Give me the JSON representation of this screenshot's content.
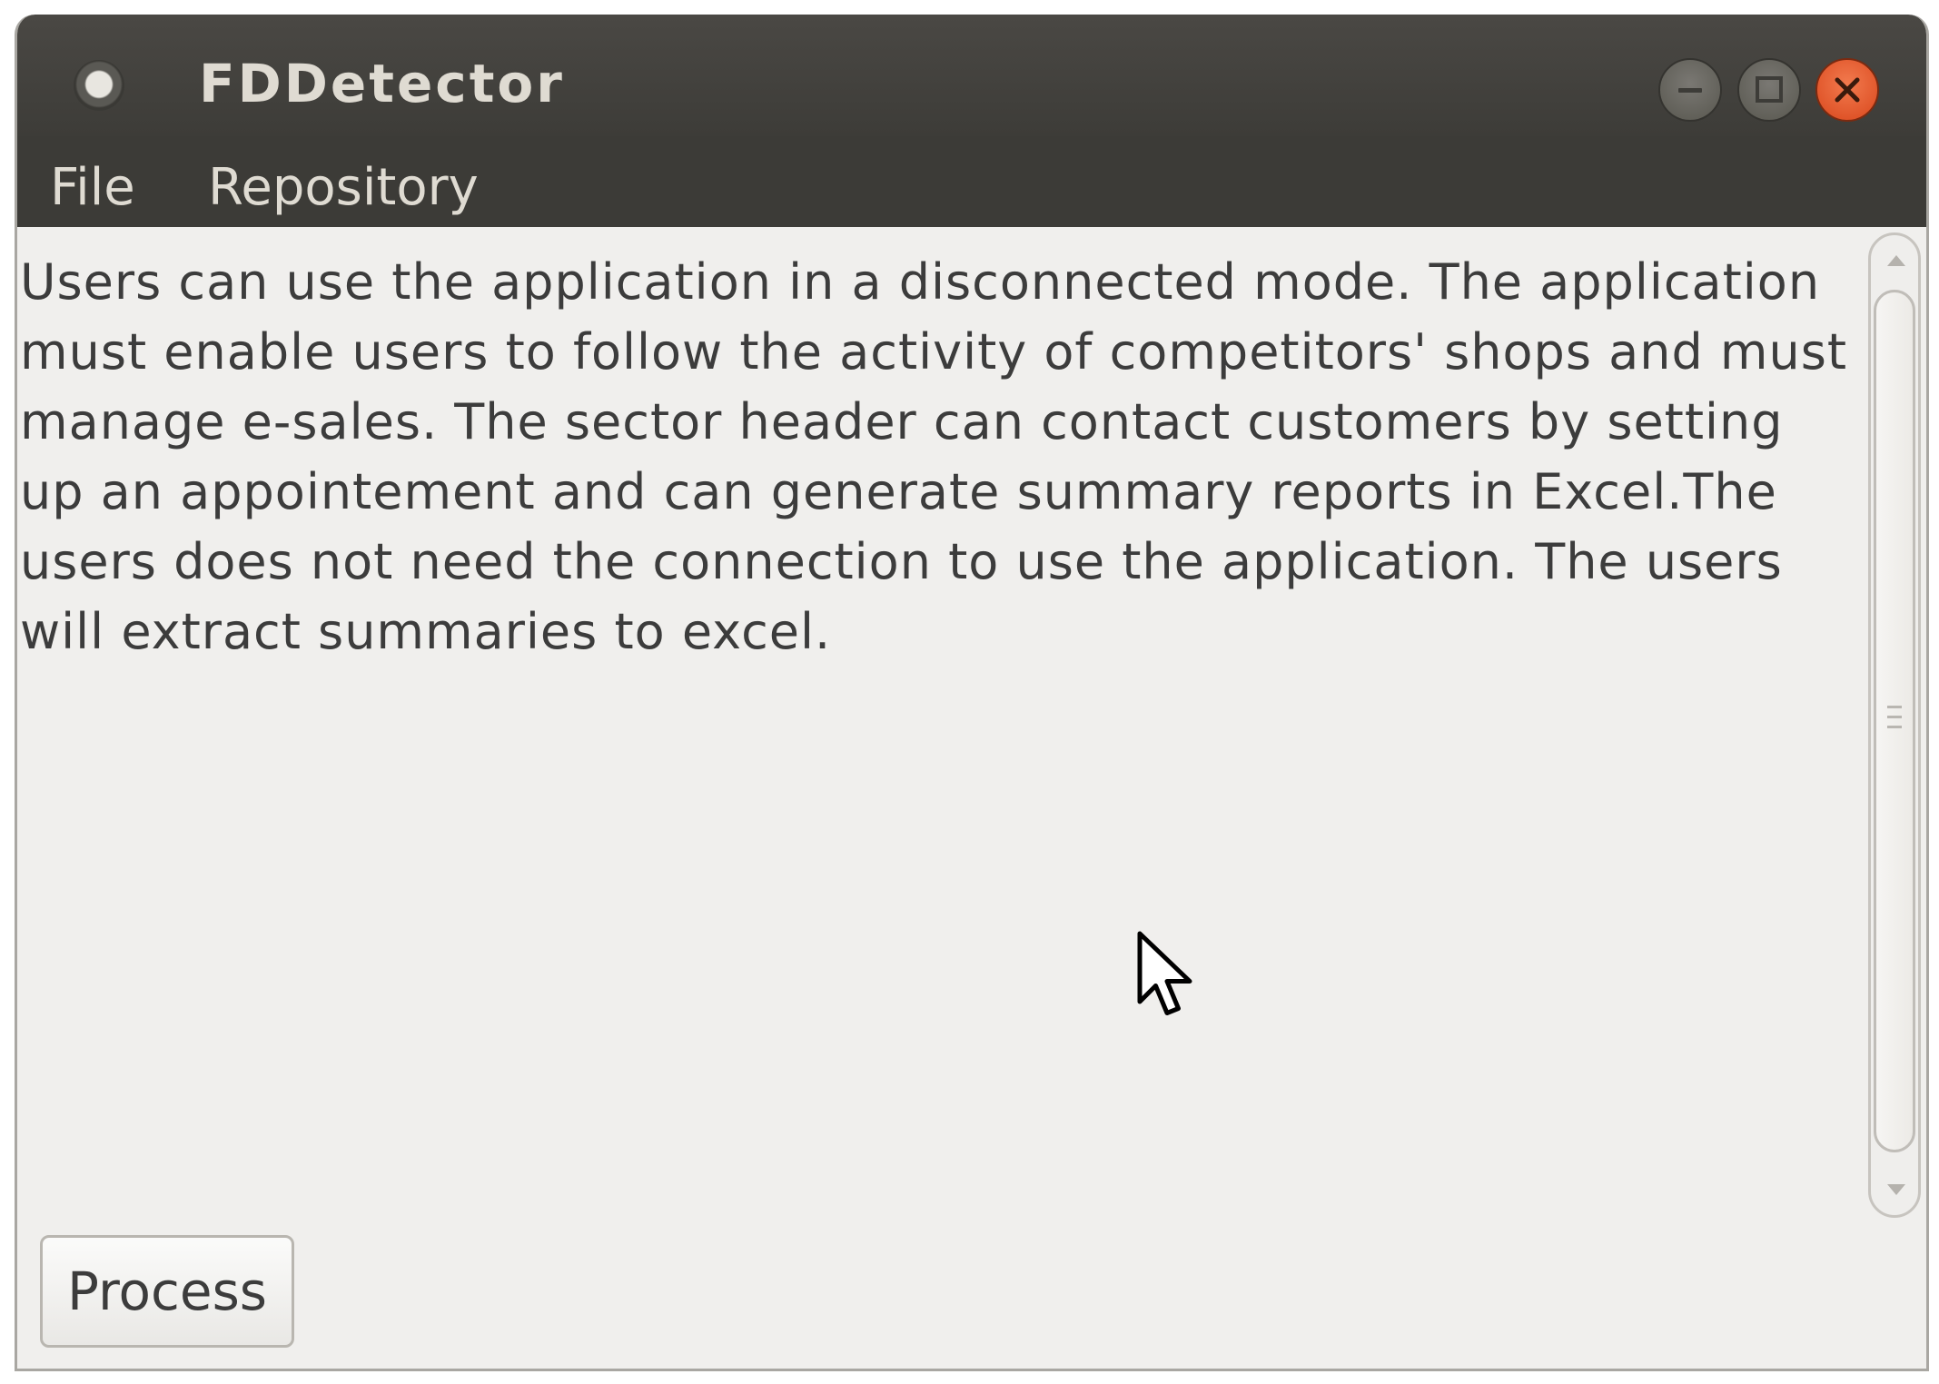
{
  "window": {
    "title": "FDDetector"
  },
  "menubar": {
    "items": [
      {
        "label": "File"
      },
      {
        "label": "Repository"
      }
    ]
  },
  "editor": {
    "text": "Users can use the application in a disconnected mode. The application must enable users to follow the activity of competitors' shops and must manage e-sales. The sector header can contact customers by setting up an appointement and can generate summary reports in Excel.The users does not need the connection to use the application. The users will extract summaries to excel."
  },
  "actions": {
    "process_label": "Process"
  },
  "icons": {
    "app": "app-icon",
    "minimize": "minimize-icon",
    "maximize": "maximize-icon",
    "close": "close-icon",
    "pointer": "mouse-pointer-icon"
  },
  "colors": {
    "titlebar": "#3c3b37",
    "close_button": "#e05a2a",
    "content_background": "#f0efed",
    "menu_text": "#dfdbd2"
  }
}
